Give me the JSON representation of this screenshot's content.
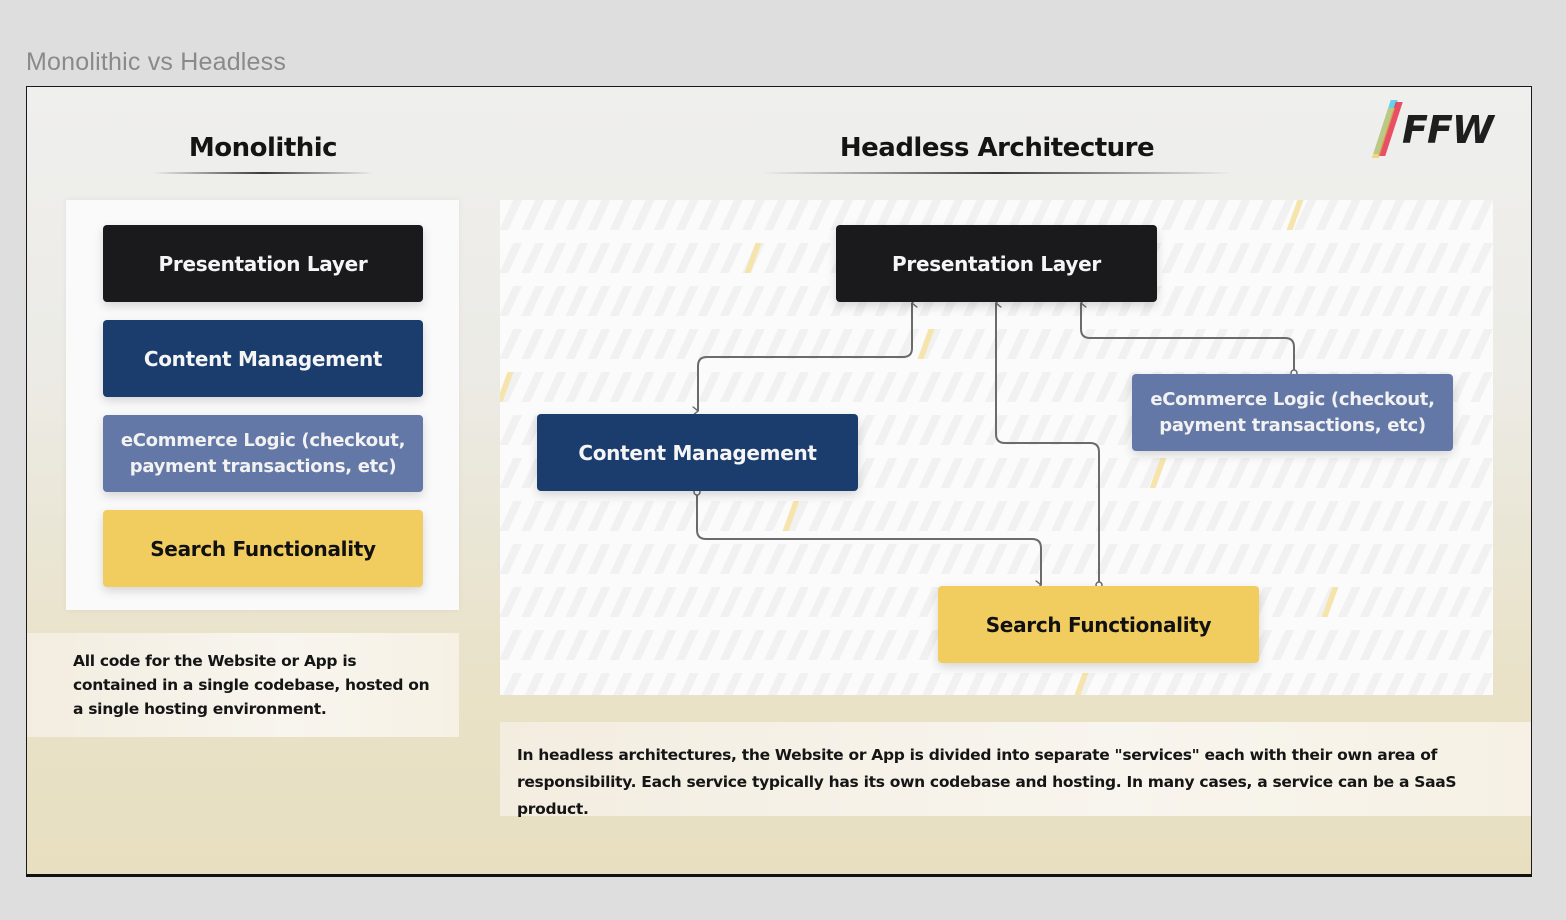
{
  "frame": {
    "title": "Monolithic vs Headless"
  },
  "logo": {
    "text": "FFW",
    "stripe_colors": [
      "#38c8e8",
      "#e8324a",
      "#f2c443",
      "#5a2a5a"
    ]
  },
  "monolithic": {
    "heading": "Monolithic",
    "layers": [
      {
        "label": "Presentation Layer",
        "color": "#1a1a1c"
      },
      {
        "label": "Content Management",
        "color": "#1b3d6e"
      },
      {
        "label": "eCommerce Logic (checkout, payment transactions, etc)",
        "color": "#6378a6"
      },
      {
        "label": "Search Functionality",
        "color": "#f1cc5f"
      }
    ],
    "description": "All code for the Website or App is contained in a single codebase, hosted on a single hosting environment."
  },
  "headless": {
    "heading": "Headless Architecture",
    "nodes": {
      "presentation": {
        "label": "Presentation Layer",
        "color": "#1a1a1c"
      },
      "content": {
        "label": "Content Management",
        "color": "#1b3d6e"
      },
      "ecommerce": {
        "label": "eCommerce Logic (checkout, payment transactions, etc)",
        "color": "#6378a6"
      },
      "search": {
        "label": "Search Functionality",
        "color": "#f1cc5f"
      }
    },
    "connections": [
      {
        "from": "presentation",
        "to": "content",
        "bidirectional": true
      },
      {
        "from": "ecommerce",
        "to": "presentation"
      },
      {
        "from": "search",
        "to": "presentation"
      },
      {
        "from": "content",
        "to": "search"
      }
    ],
    "description": "In headless architectures, the Website or App is divided into separate \"services\" each with their own area of responsibility. Each service typically has its own codebase and hosting. In many cases, a service can be a SaaS product."
  },
  "colors": {
    "connector": "#6b6b6b",
    "accent_dash": "#f6e4ad"
  }
}
